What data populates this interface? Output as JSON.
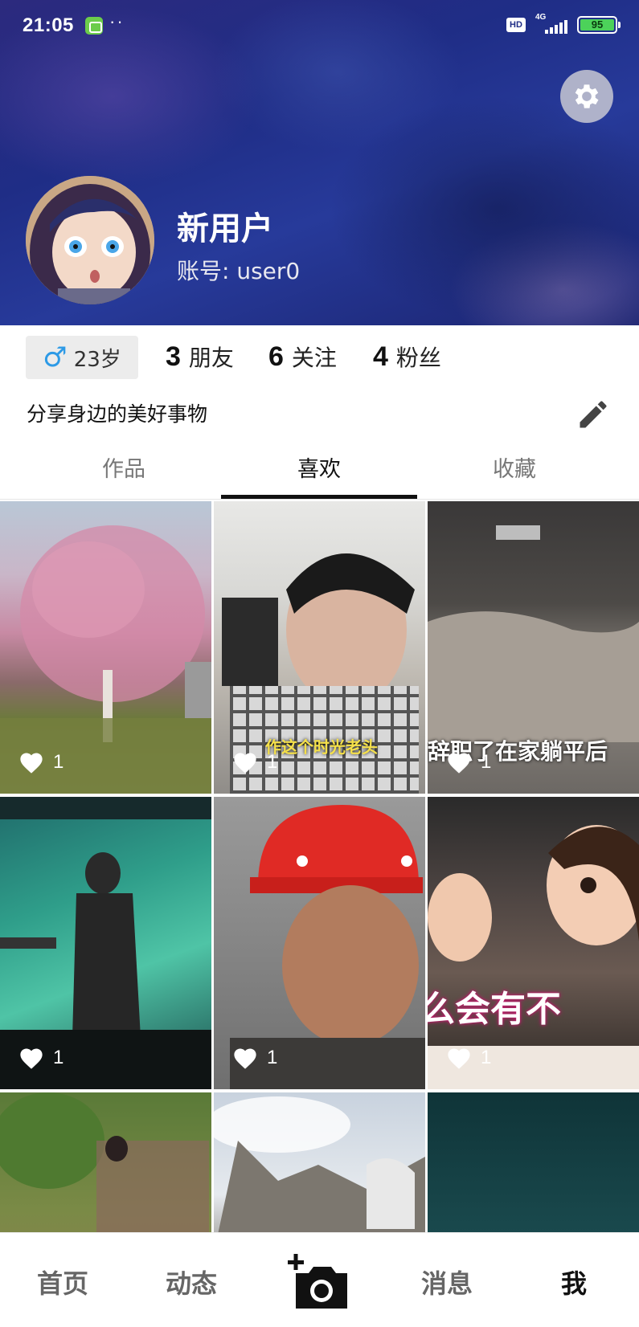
{
  "status_bar": {
    "time": "21:05",
    "dots": "··",
    "hd": "HD",
    "network": "4G",
    "battery": "95"
  },
  "profile": {
    "name": "新用户",
    "account": "账号: user0",
    "age": "23岁",
    "gender_icon": "male-icon",
    "bio": "分享身边的美好事物",
    "stats": [
      {
        "num": "3",
        "label": "朋友"
      },
      {
        "num": "6",
        "label": "关注"
      },
      {
        "num": "4",
        "label": "粉丝"
      }
    ]
  },
  "tabs": [
    {
      "label": "作品",
      "active": false
    },
    {
      "label": "喜欢",
      "active": true
    },
    {
      "label": "收藏",
      "active": false
    }
  ],
  "videos": [
    {
      "likes": "1",
      "caption": ""
    },
    {
      "likes": "1",
      "caption": "作这个时光老头"
    },
    {
      "likes": "1",
      "caption": "辞职了在家躺平后"
    },
    {
      "likes": "1",
      "caption": ""
    },
    {
      "likes": "1",
      "caption": ""
    },
    {
      "likes": "1",
      "caption": "么会有不"
    },
    {
      "likes": "",
      "caption": ""
    },
    {
      "likes": "",
      "caption": ""
    },
    {
      "likes": "",
      "caption": ""
    }
  ],
  "nav": {
    "home": "首页",
    "feed": "动态",
    "messages": "消息",
    "me": "我"
  },
  "colors": {
    "banner": "#1f2d86",
    "male_blue": "#2d9ae6",
    "battery_green": "#4cd25a"
  }
}
